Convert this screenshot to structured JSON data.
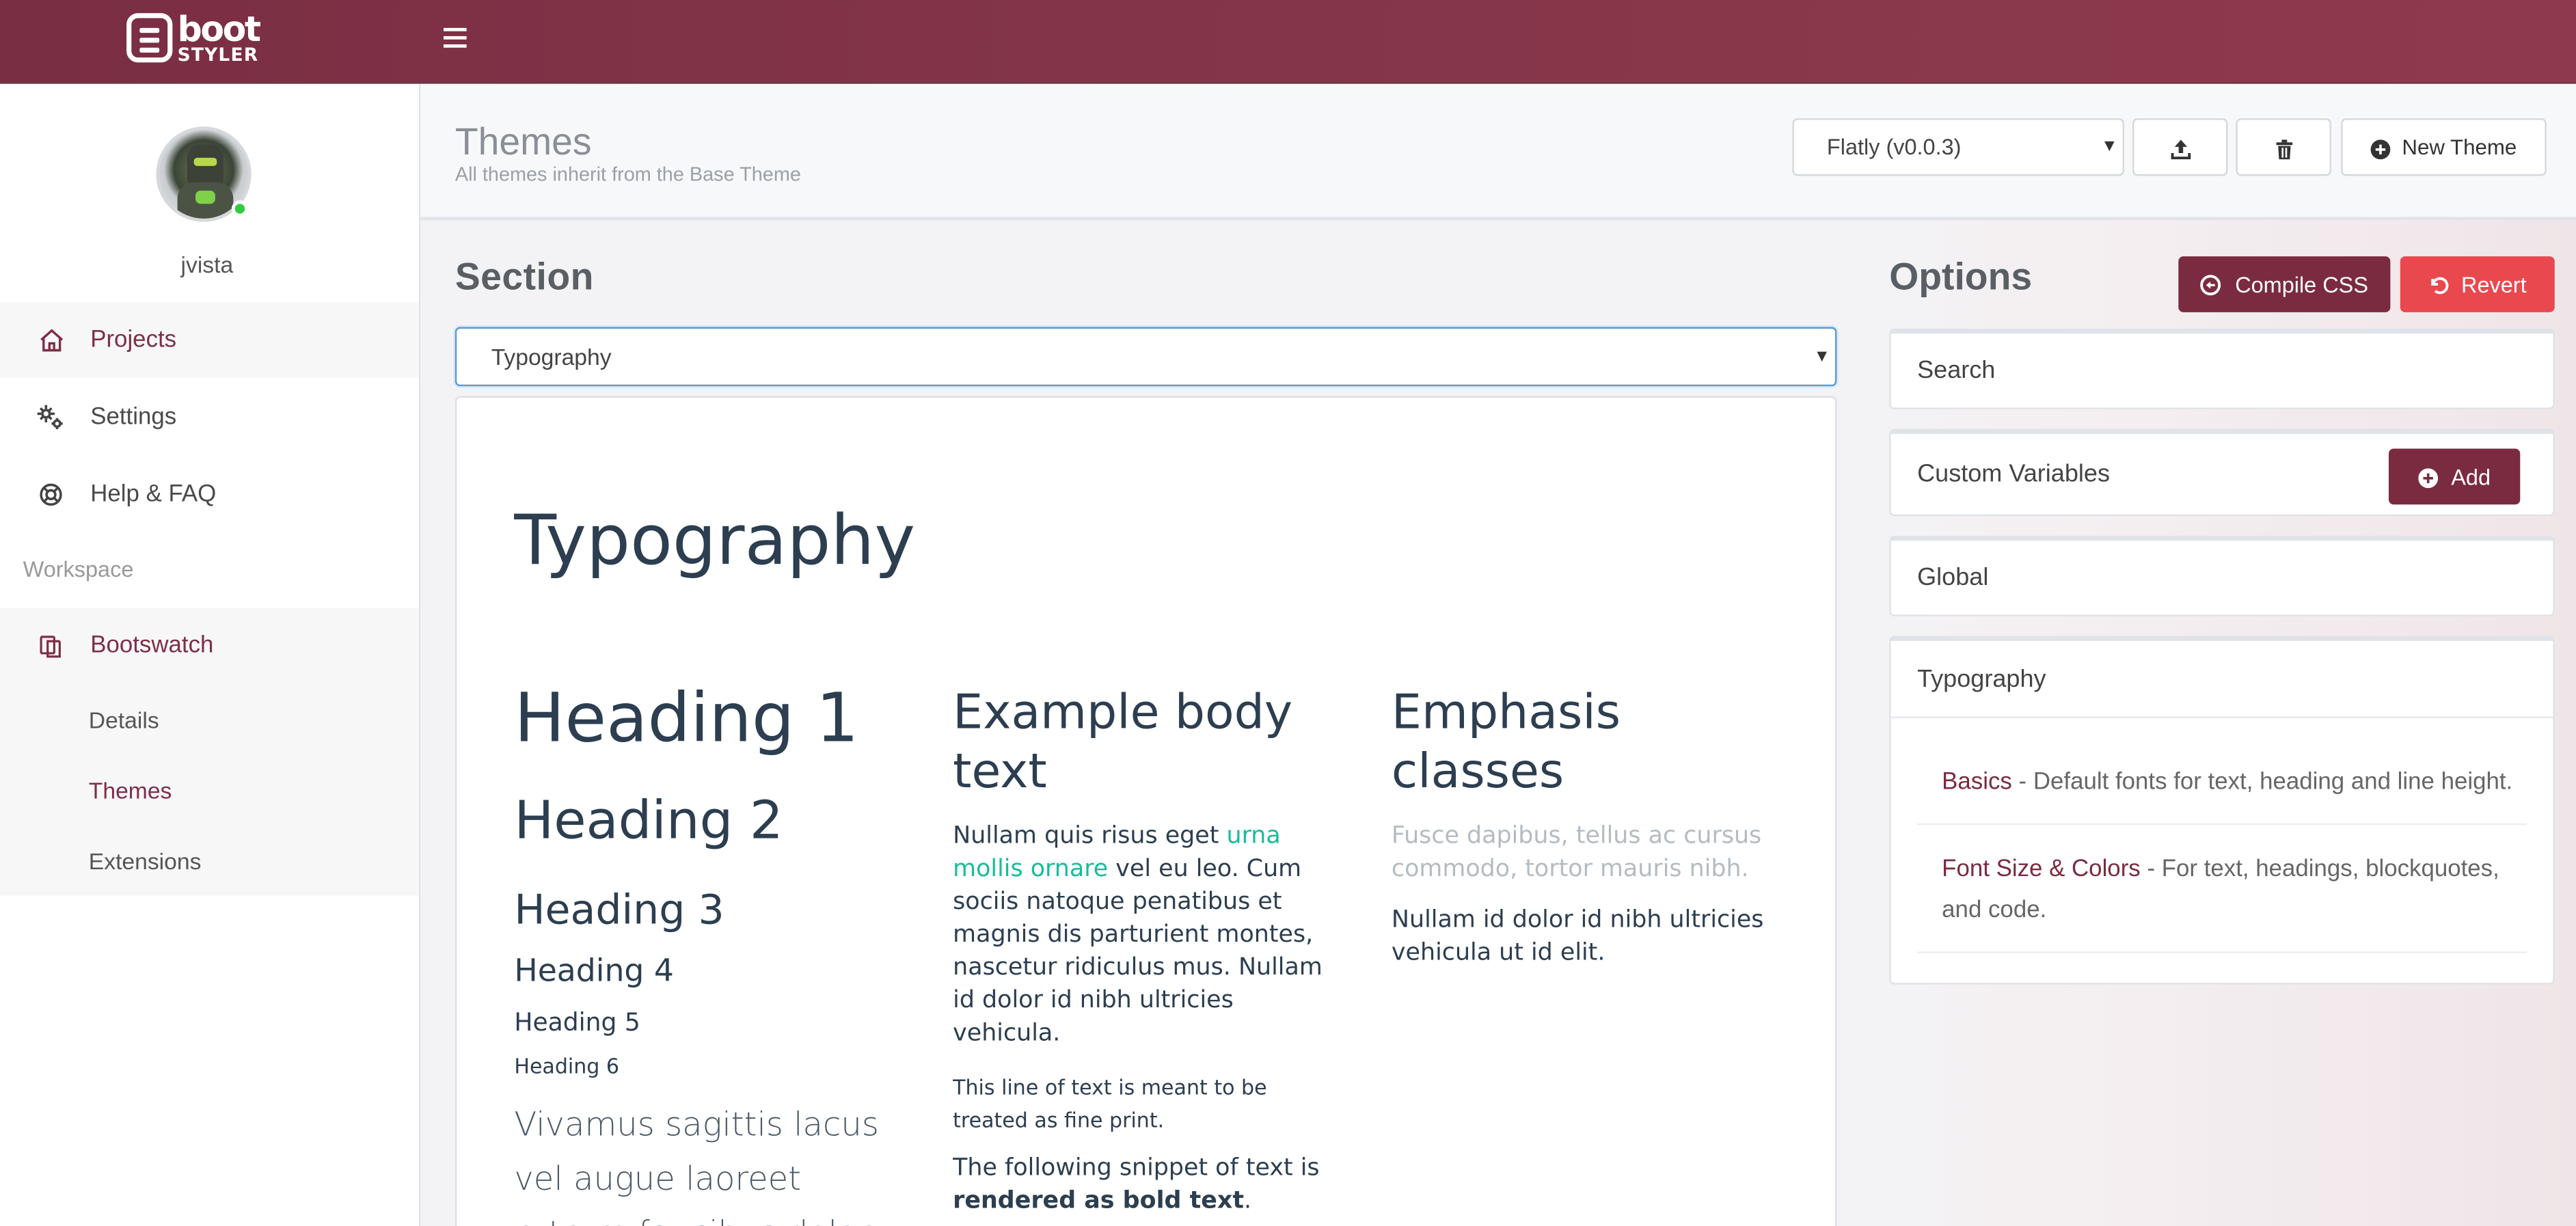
{
  "app": {
    "logo_line1": "boot",
    "logo_line2": "STYLER"
  },
  "user": {
    "name": "jvista",
    "status_color": "#2ecc40"
  },
  "sidebar": {
    "items": [
      {
        "label": "Projects",
        "icon": "home-icon"
      },
      {
        "label": "Settings",
        "icon": "gears-icon"
      },
      {
        "label": "Help & FAQ",
        "icon": "life-ring-icon"
      }
    ],
    "workspace_label": "Workspace",
    "workspace": {
      "label": "Bootswatch",
      "icon": "copy-icon"
    },
    "sub_items": [
      {
        "label": "Details"
      },
      {
        "label": "Themes"
      },
      {
        "label": "Extensions"
      }
    ]
  },
  "header": {
    "title": "Themes",
    "subtitle": "All themes inherit from the Base Theme",
    "theme_select_value": "Flatly (v0.0.3)",
    "new_theme_label": "New Theme",
    "upload_icon": "upload-icon",
    "delete_icon": "trash-icon"
  },
  "section": {
    "title": "Section",
    "select_value": "Typography"
  },
  "preview": {
    "title": "Typography",
    "headings": [
      "Heading 1",
      "Heading 2",
      "Heading 3",
      "Heading 4",
      "Heading 5",
      "Heading 6"
    ],
    "lead": "Vivamus sagittis lacus vel augue laoreet rutrum faucibus dolor",
    "body_title": "Example body text",
    "body_before_link": "Nullam quis risus eget ",
    "body_link": "urna mollis ornare",
    "body_after_link": " vel eu leo. Cum sociis natoque penatibus et magnis dis parturient montes, nascetur ridiculus mus. Nullam id dolor id nibh ultricies vehicula.",
    "fine_print": "This line of text is meant to be treated as fine print.",
    "bold_before": "The following snippet of text is ",
    "bold_text": "rendered as bold text",
    "bold_after": ".",
    "emphasis_title": "Emphasis classes",
    "muted_text": "Fusce dapibus, tellus ac cursus commodo, tortor mauris nibh.",
    "emphasis_text": "Nullam id dolor id nibh ultricies vehicula ut id elit.",
    "link_color": "#18bc9c",
    "text_color": "#2c3e50"
  },
  "options": {
    "title": "Options",
    "compile_label": "Compile CSS",
    "revert_label": "Revert",
    "panels": [
      {
        "label": "Search"
      },
      {
        "label": "Custom Variables",
        "add_label": "Add"
      },
      {
        "label": "Global"
      },
      {
        "label": "Typography"
      }
    ],
    "typography_items": [
      {
        "key": "Basics",
        "desc": " - Default fonts for text, heading and line height."
      },
      {
        "key": "Font Size & Colors",
        "desc": " - For text, headings, blockquotes, and code."
      }
    ]
  },
  "colors": {
    "brand": "#7b2b40",
    "danger": "#e9484f",
    "topbar": "#853549"
  }
}
